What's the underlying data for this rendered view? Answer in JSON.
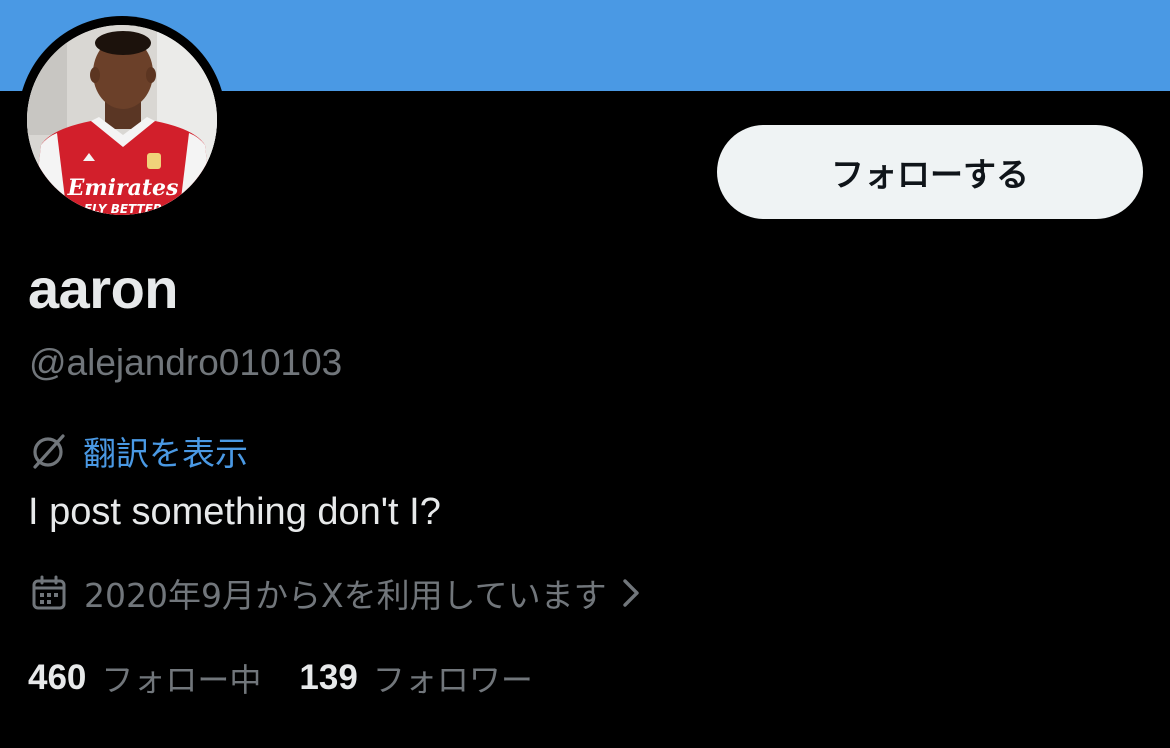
{
  "profile": {
    "display_name": "aaron",
    "handle": "@alejandro010103",
    "bio": "I post something don't I?",
    "follow_button_label": "フォローする",
    "translate_label": "翻訳を表示",
    "joined_text": "2020年9月からXを利用しています",
    "following": {
      "count": "460",
      "label": "フォロー中"
    },
    "followers": {
      "count": "139",
      "label": "フォロワー"
    }
  },
  "avatar": {
    "shirt_sponsor_line1": "Emirates",
    "shirt_sponsor_line2": "FLY BETTER"
  },
  "icons": {
    "translate": "globe-slash-icon",
    "calendar": "calendar-icon",
    "chevron": "chevron-right-icon"
  },
  "colors": {
    "banner": "#4a99e4",
    "background": "#000000",
    "primary_text": "#e7e9ea",
    "secondary_text": "#71767b",
    "link": "#4a99e4",
    "follow_button_bg": "#eff3f4",
    "follow_button_text": "#0f1419"
  }
}
